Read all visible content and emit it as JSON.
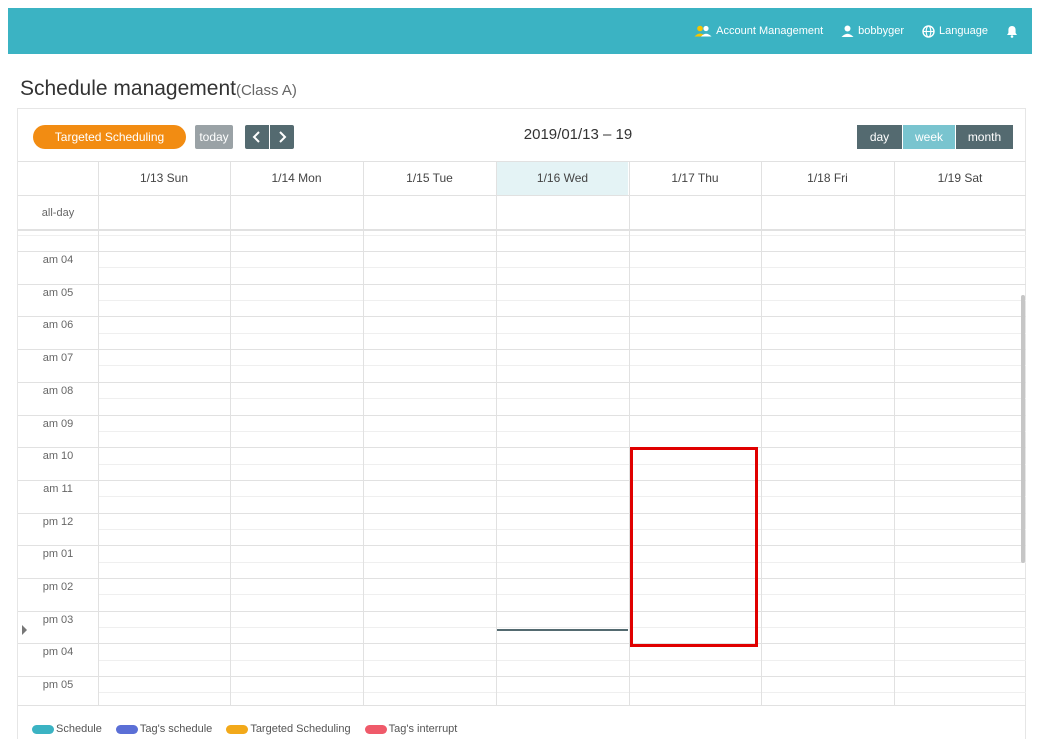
{
  "topnav": {
    "account_label": "Account Management",
    "user_label": "bobbyger",
    "language_label": "Language",
    "bar_color": "#3bb3c3"
  },
  "page": {
    "title": "Schedule management",
    "subtitle": "(Class A)"
  },
  "toolbar": {
    "targeted_label": "Targeted Scheduling",
    "today_label": "today",
    "prev_icon": "chevron-left-icon",
    "next_icon": "chevron-right-icon",
    "range_label": "2019/01/13 – 19",
    "views": [
      "day",
      "week",
      "month"
    ],
    "active_view": "week"
  },
  "calendar": {
    "days": [
      "1/13 Sun",
      "1/14 Mon",
      "1/15 Tue",
      "1/16 Wed",
      "1/17 Thu",
      "1/18 Fri",
      "1/19 Sat"
    ],
    "today_day": "1/16 Wed",
    "allday_label": "all-day",
    "time_slots": [
      "am 04",
      "am 05",
      "am 06",
      "am 07",
      "am 08",
      "am 09",
      "am 10",
      "am 11",
      "pm 12",
      "pm 01",
      "pm 02",
      "pm 03",
      "pm 04",
      "pm 05"
    ]
  },
  "legend": [
    {
      "label": "Schedule",
      "color": "#3bb3c3"
    },
    {
      "label": "Tag's schedule",
      "color": "#5b6fd6"
    },
    {
      "label": "Targeted Scheduling",
      "color": "#f2a91a"
    },
    {
      "label": "Tag's interrupt",
      "color": "#ef5a6a"
    }
  ]
}
